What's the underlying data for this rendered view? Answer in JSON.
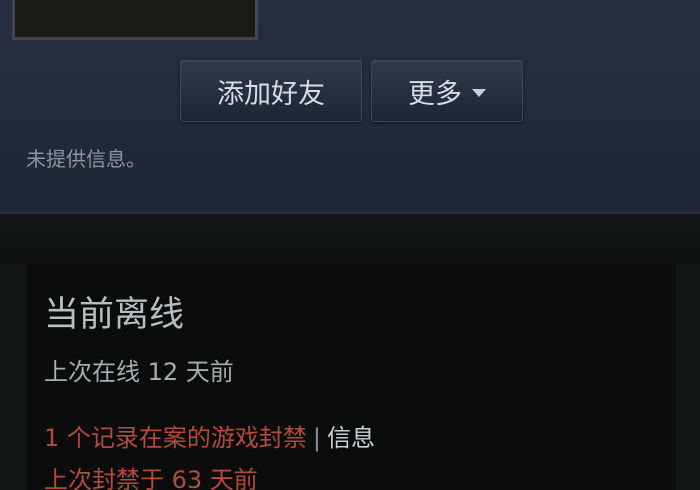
{
  "profile": {
    "add_friend_label": "添加好友",
    "more_label": "更多",
    "no_info_text": "未提供信息。"
  },
  "status": {
    "title": "当前离线",
    "last_online": "上次在线 12 天前",
    "ban_record": "1 个记录在案的游戏封禁",
    "separator": "|",
    "info_link": "信息",
    "last_ban": "上次封禁于 63 天前"
  },
  "colors": {
    "header_bg": "#232b3c",
    "panel_bg": "#0a0d0c",
    "ban_red": "#b34a3a",
    "text_light": "#d6dde6"
  },
  "icons": {
    "more_dropdown": "caret-down-icon"
  }
}
